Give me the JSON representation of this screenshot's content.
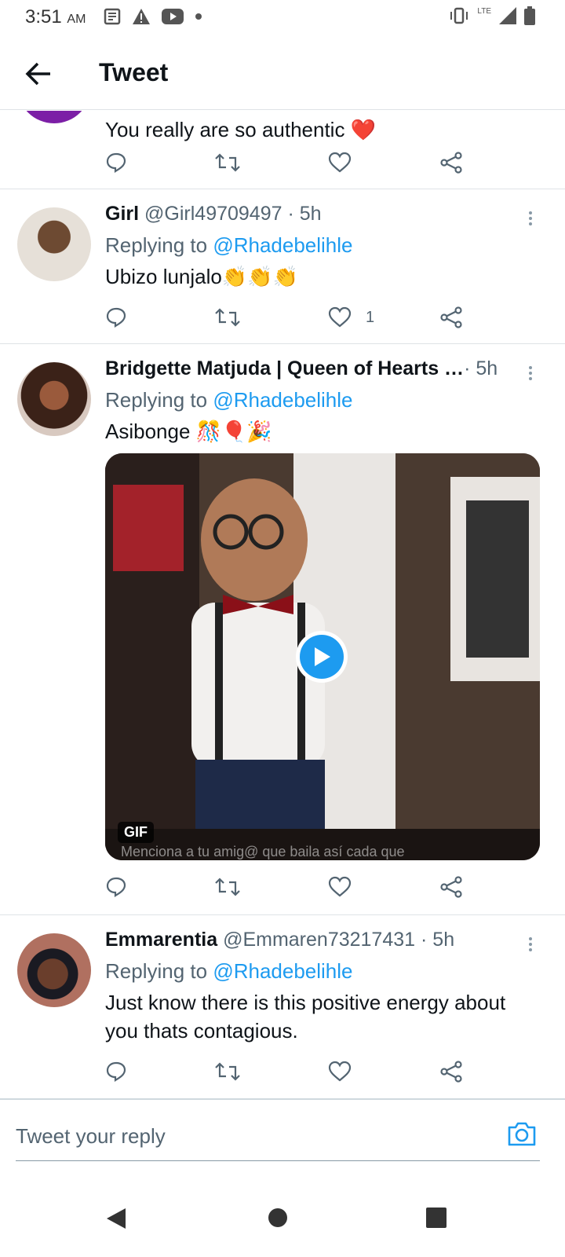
{
  "status_bar": {
    "time": "3:51",
    "ampm": "AM",
    "network": "LTE"
  },
  "header": {
    "title": "Tweet"
  },
  "colors": {
    "accent": "#1d9bf0",
    "text": "#0f1419",
    "secondary": "#536471",
    "divider": "#dfe3e6"
  },
  "tweets": [
    {
      "text": "You really  are so authentic ❤️",
      "likes": ""
    },
    {
      "name": "Girl",
      "handle": "@Girl49709497",
      "time": "· 5h",
      "replying_prefix": "Replying to ",
      "replying_to": "@Rhadebelihle",
      "text": "Ubizo lunjalo👏👏👏",
      "likes": "1"
    },
    {
      "name": "Bridgette Matjuda | Queen of Hearts …",
      "handle": "",
      "time": "· 5h",
      "replying_prefix": "Replying to ",
      "replying_to": "@Rhadebelihle",
      "text": "Asibonge 🎊🎈🎉",
      "media": {
        "badge": "GIF",
        "caption": "Menciona a tu amig@ que baila así cada que"
      },
      "likes": ""
    },
    {
      "name": "Emmarentia",
      "handle": "@Emmaren73217431",
      "time": "· 5h",
      "replying_prefix": "Replying to ",
      "replying_to": "@Rhadebelihle",
      "text": "Just know there is this positive energy about you thats contagious.",
      "likes": ""
    }
  ],
  "composer": {
    "placeholder": "Tweet your reply"
  }
}
